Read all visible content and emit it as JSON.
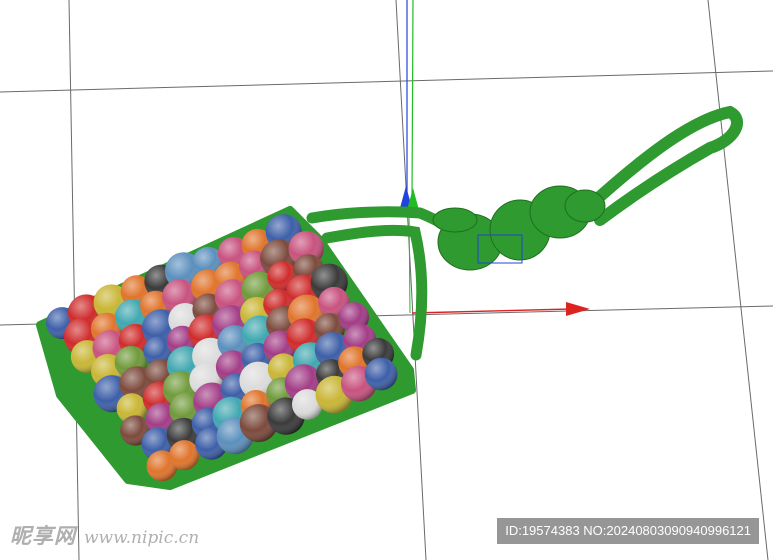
{
  "viewport": {
    "background": "#ffffff",
    "grid_color": "#666666"
  },
  "axes": {
    "x_color": "#dd2222",
    "y_color": "#22bb22",
    "z_color": "#2244dd"
  },
  "model": {
    "rope_color": "#2f9a2f",
    "ball_colors": [
      "#cf2b2b",
      "#3d5fa8",
      "#6f9a3a",
      "#c9b635",
      "#a23c86",
      "#e0742b",
      "#3a3a3a",
      "#dcdcdc",
      "#c8527e",
      "#3fa7b0",
      "#7c4a3c",
      "#5b8fbd"
    ]
  },
  "watermark": {
    "brand": "昵享网",
    "url": "www.nipic.cn",
    "info": "ID:19574383 NO:20240803090940996121"
  }
}
